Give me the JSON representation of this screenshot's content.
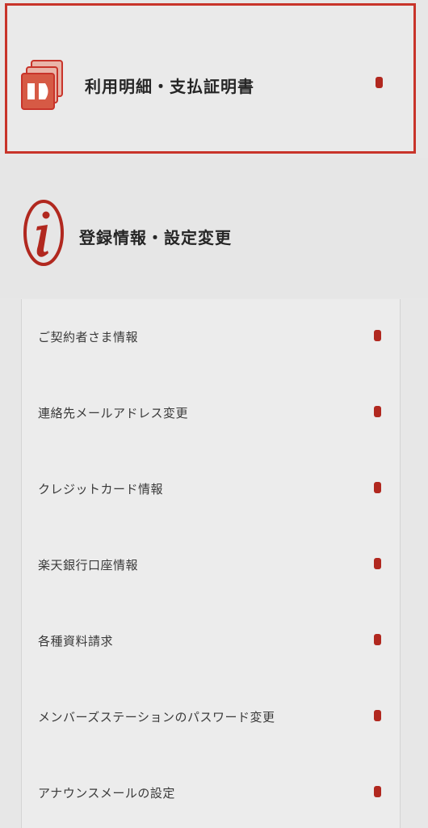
{
  "menu": {
    "statement": {
      "label": "利用明細・支払証明書",
      "icon": "statement-icon",
      "highlight_color": "#c8342a"
    },
    "registration": {
      "label": "登録情報・設定変更",
      "icon": "info-icon"
    },
    "sub_items": [
      {
        "label": "ご契約者さま情報"
      },
      {
        "label": "連絡先メールアドレス変更"
      },
      {
        "label": "クレジットカード情報"
      },
      {
        "label": "楽天銀行口座情報"
      },
      {
        "label": "各種資料請求"
      },
      {
        "label": "メンバーズステーションのパスワード変更"
      },
      {
        "label": "アナウンスメールの設定"
      }
    ],
    "accent_color": "#b1281f"
  }
}
